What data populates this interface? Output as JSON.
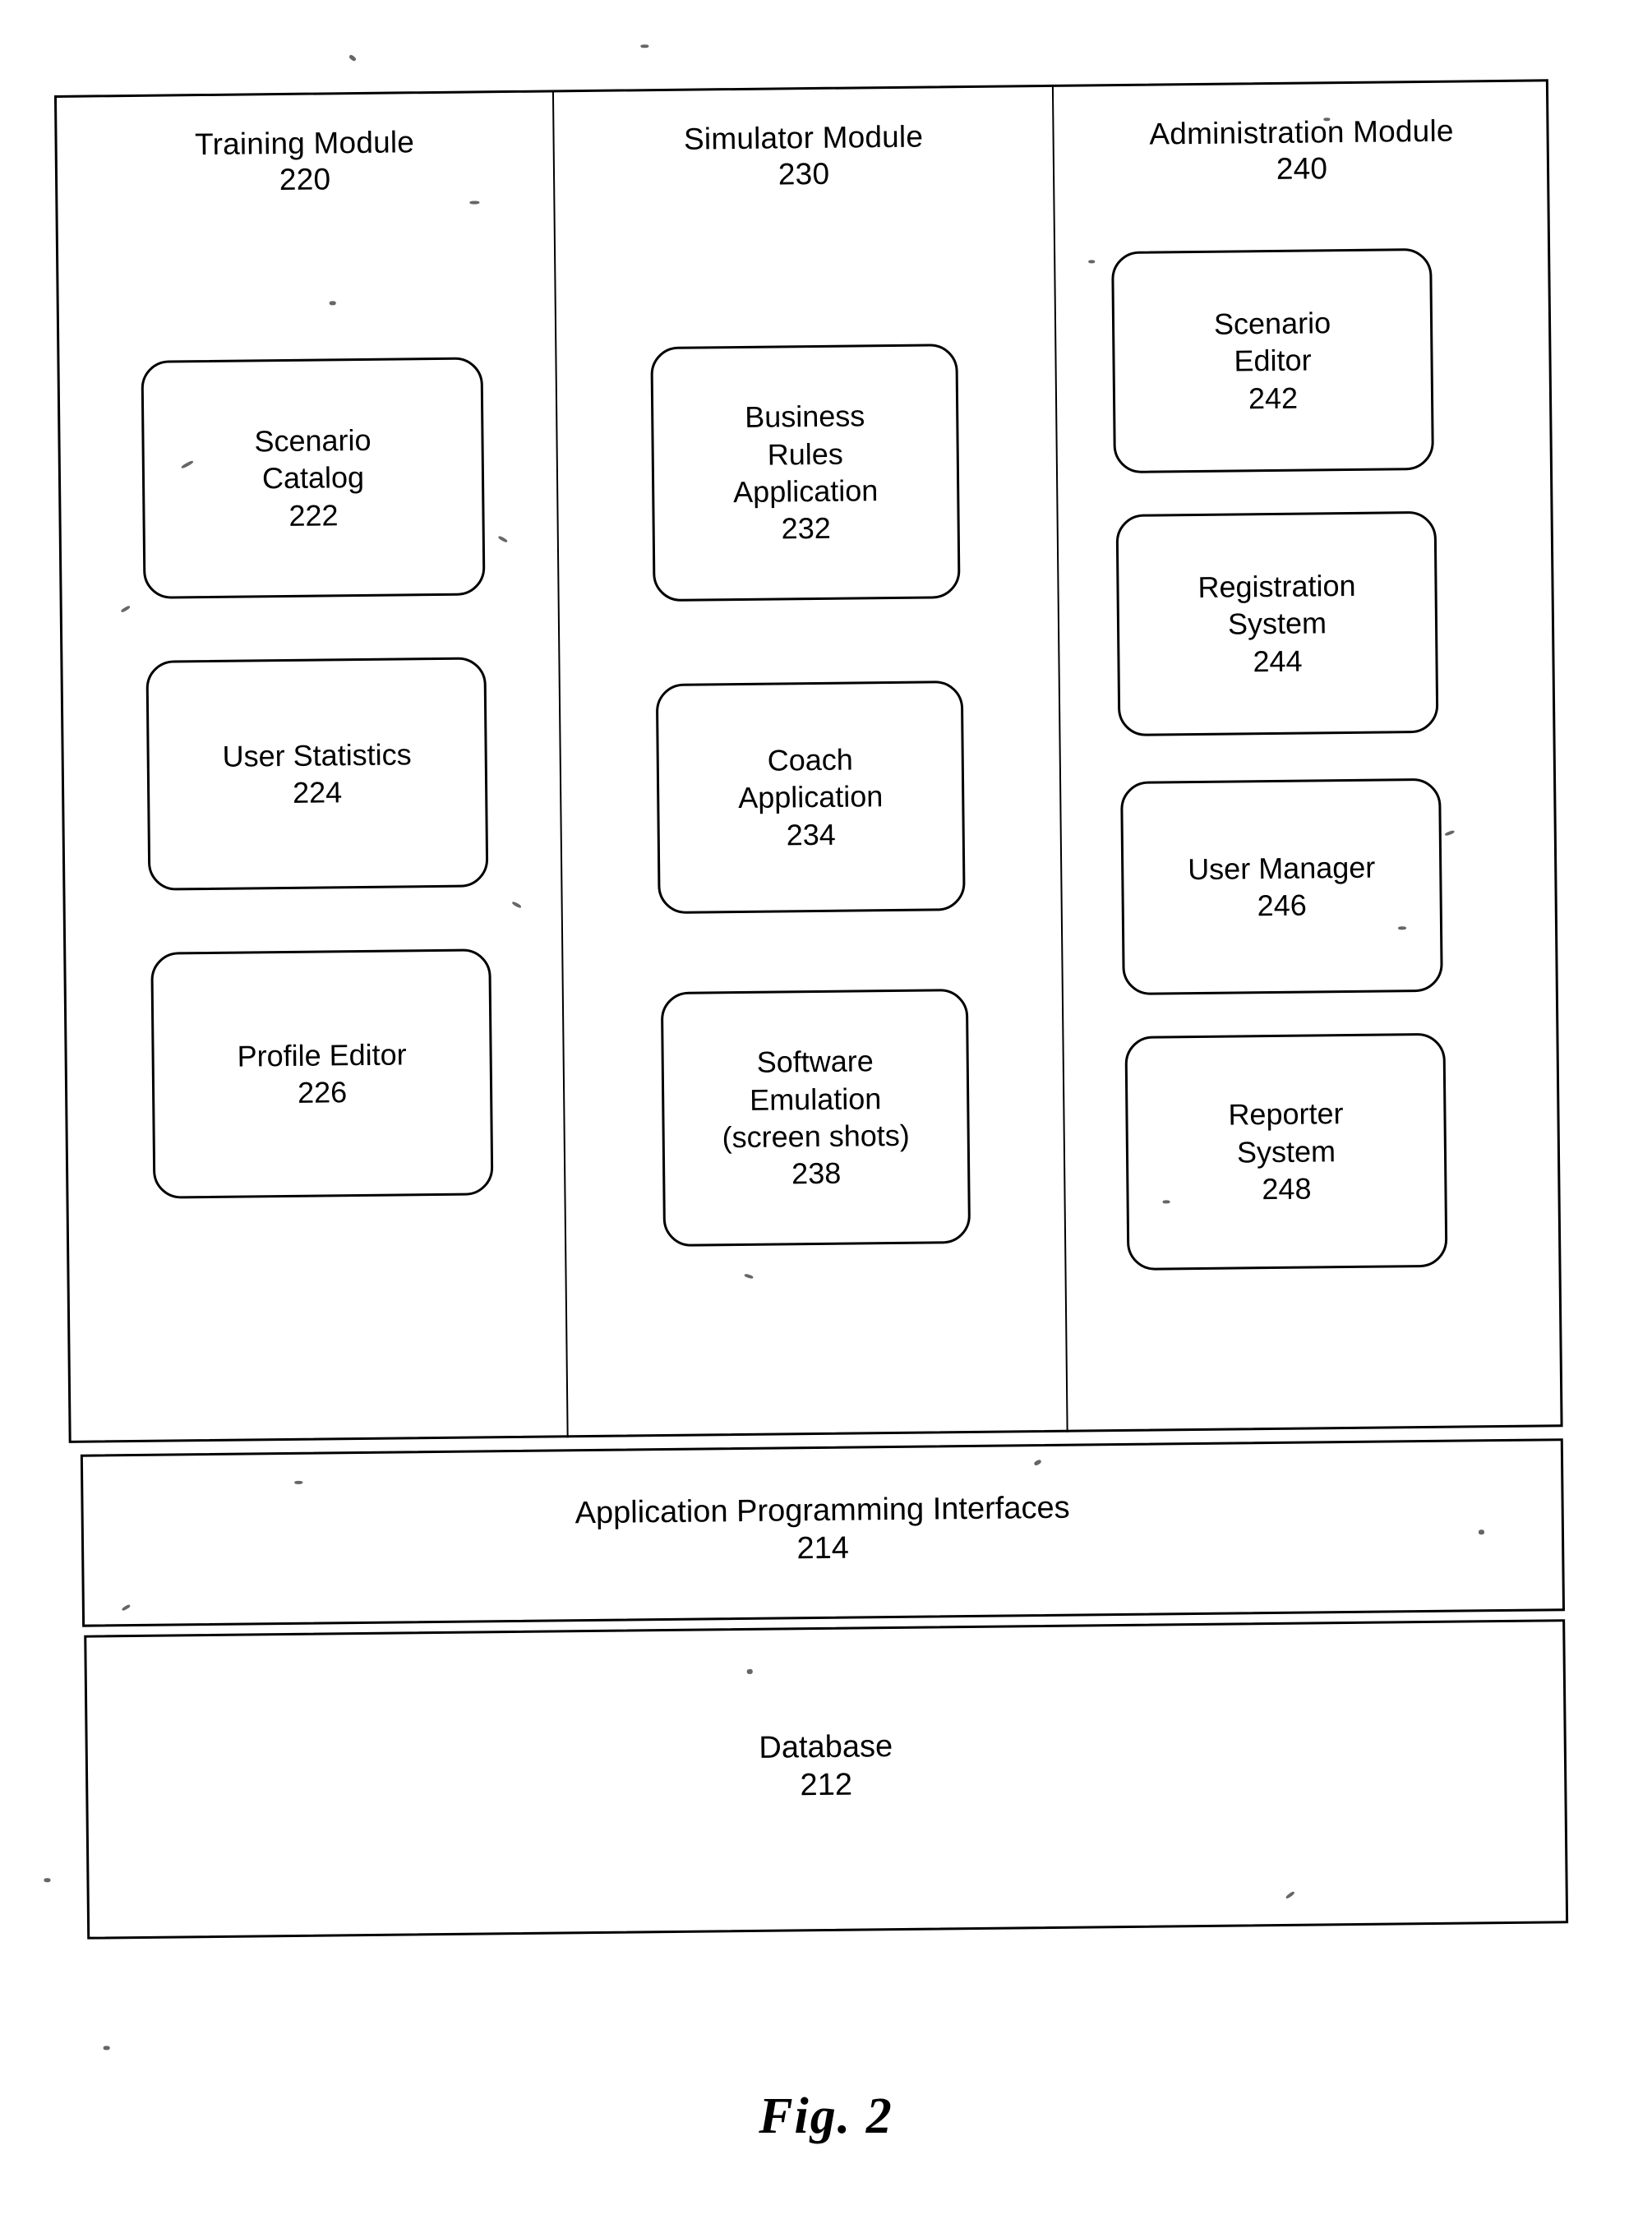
{
  "figure": {
    "caption": "Fig. 2"
  },
  "modules": [
    {
      "name": "Training Module",
      "ref": "220",
      "components": [
        {
          "lines": [
            "Scenario",
            "Catalog"
          ],
          "ref": "222"
        },
        {
          "lines": [
            "User Statistics"
          ],
          "ref": "224"
        },
        {
          "lines": [
            "Profile Editor"
          ],
          "ref": "226"
        }
      ]
    },
    {
      "name": "Simulator Module",
      "ref": "230",
      "components": [
        {
          "lines": [
            "Business",
            "Rules",
            "Application"
          ],
          "ref": "232"
        },
        {
          "lines": [
            "Coach",
            "Application"
          ],
          "ref": "234"
        },
        {
          "lines": [
            "Software",
            "Emulation",
            "(screen shots)"
          ],
          "ref": "238"
        }
      ]
    },
    {
      "name": "Administration Module",
      "ref": "240",
      "components": [
        {
          "lines": [
            "Scenario",
            "Editor"
          ],
          "ref": "242"
        },
        {
          "lines": [
            "Registration",
            "System"
          ],
          "ref": "244"
        },
        {
          "lines": [
            "User Manager"
          ],
          "ref": "246"
        },
        {
          "lines": [
            "Reporter",
            "System"
          ],
          "ref": "248"
        }
      ]
    }
  ],
  "bands": [
    {
      "name": "Application Programming Interfaces",
      "ref": "214"
    },
    {
      "name": "Database",
      "ref": "212"
    }
  ],
  "colors": {
    "ink": "#000000",
    "paper": "#ffffff"
  }
}
